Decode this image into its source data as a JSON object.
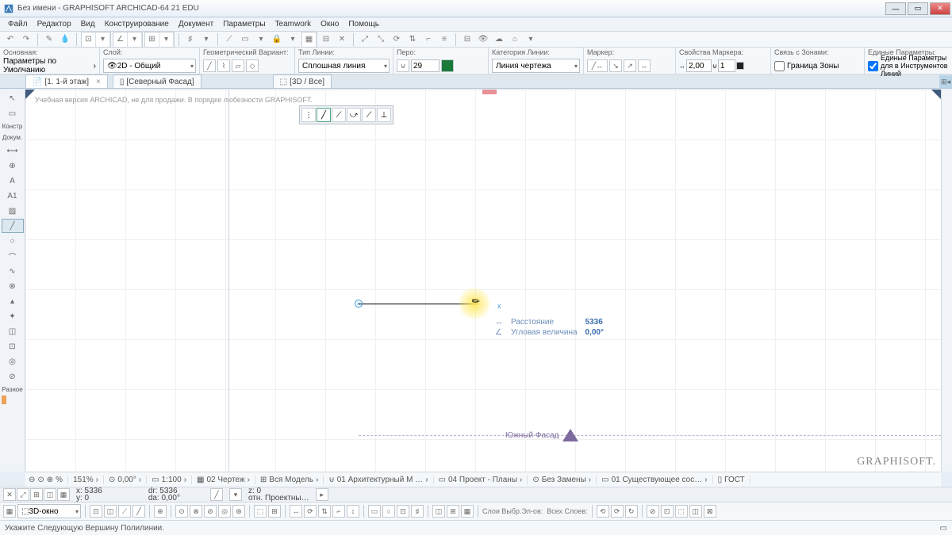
{
  "title": "Без имени - GRAPHISOFT ARCHICAD-64 21 EDU",
  "menu": [
    "Файл",
    "Редактор",
    "Вид",
    "Конструирование",
    "Документ",
    "Параметры",
    "Teamwork",
    "Окно",
    "Помощь"
  ],
  "info": {
    "col1": {
      "label": "Основная:",
      "value": "Параметры по Умолчанию"
    },
    "col2": {
      "label": "Слой:",
      "value": "2D - Общий"
    },
    "col3": {
      "label": "Геометрический Вариант:"
    },
    "col4": {
      "label": "Тип Линии:",
      "value": "Сплошная линия"
    },
    "col5": {
      "label": "Перо:",
      "value": "29"
    },
    "col6": {
      "label": "Категория Линии:",
      "value": "Линия чертежа"
    },
    "col7": {
      "label": "Маркер:"
    },
    "col8": {
      "label": "Свойства Маркера:",
      "v1": "2,00",
      "v2": "1"
    },
    "col9": {
      "label": "Связь с Зонами:",
      "chk": "Граница Зоны"
    },
    "col10": {
      "label": "Единые Параметры:",
      "chk": "Единые Параметры для в Инструментов Линий"
    }
  },
  "tabs": [
    {
      "label": "[1. 1-й этаж]",
      "active": true,
      "closable": true
    },
    {
      "label": "[Северный Фасад]",
      "active": false
    },
    {
      "label": "[3D / Все]",
      "active": false
    }
  ],
  "left": {
    "s1": "Констр",
    "s2": "Докум.",
    "s3": "Разное"
  },
  "watermark": "Учебная версия ARCHICAD, не для продажи. В порядке любезности GRAPHISOFT.",
  "tracker": {
    "l1": "Расстояние",
    "v1": "5336",
    "l2": "Угловая величина",
    "v2": "0,00°"
  },
  "xmark": "x",
  "elev": "Южный Фасад",
  "brand": "GRAPHISOFT.",
  "status": {
    "zoom": "151%",
    "ang": "0,00°",
    "scale": "1:100",
    "s1": "02 Чертеж",
    "s2": "Вся Модель",
    "s3": "01 Архитектурный М …",
    "s4": "04 Проект - Планы",
    "s5": "Без Замены",
    "s6": "01 Существующее сос…",
    "s7": "ГОСТ"
  },
  "coords": {
    "x": "x: 5336",
    "y": "y: 0",
    "dr": "dr: 5336",
    "da": "da: 0,00°",
    "z": "z: 0",
    "rel": "отн. Проектны…"
  },
  "bot": {
    "win": "3D-окно"
  },
  "hint": "Укажите Следующую Вершину Полилинии."
}
